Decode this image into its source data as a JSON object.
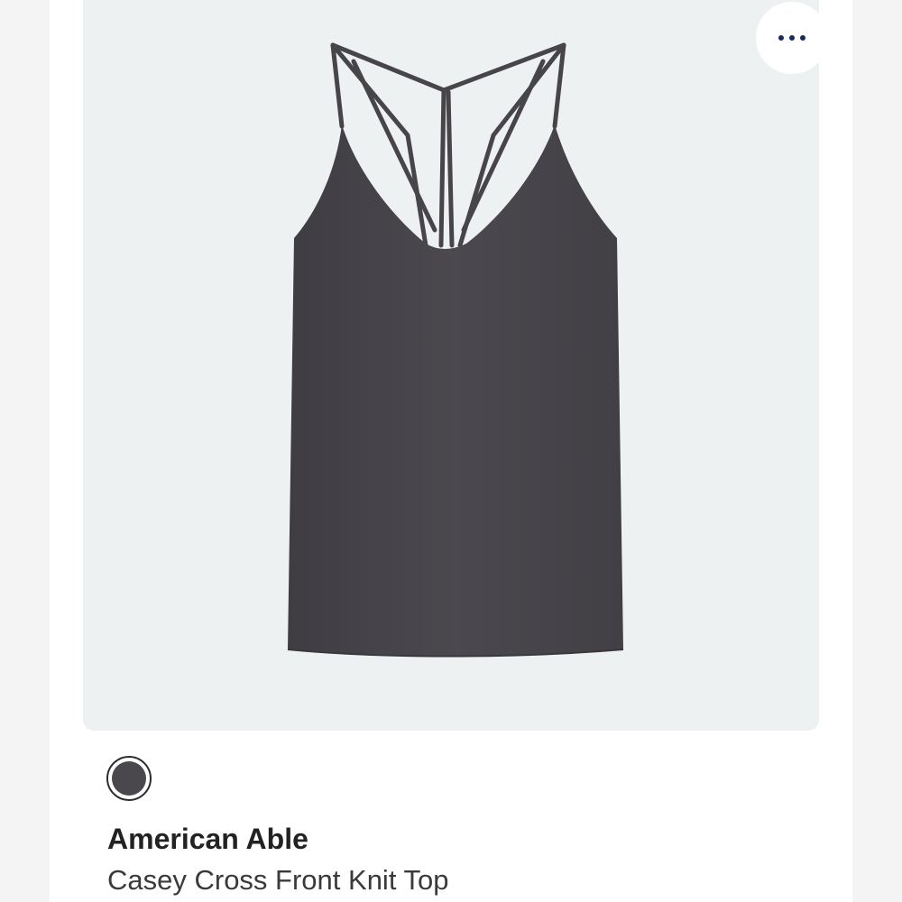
{
  "product": {
    "brand": "American Able",
    "name": "Casey Cross Front Knit Top",
    "image_alt": "Charcoal strappy knit tank top",
    "garment_color": "#4a484c"
  },
  "actions": {
    "more_icon": "more-horizontal-icon",
    "more_icon_color": "#1b2a5e"
  },
  "swatches": [
    {
      "color": "#4a484c",
      "selected": true
    }
  ],
  "colors": {
    "card_background": "#eef1f2",
    "page_background": "#ffffff"
  }
}
